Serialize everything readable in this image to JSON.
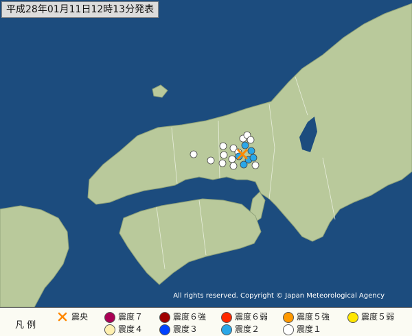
{
  "title": "平成28年01月11日12時13分発表",
  "copyright": "All rights reserved. Copyright © Japan Meteorological Agency",
  "colors": {
    "sea": "#1c4c7e",
    "land": "#b9c99b",
    "epicenter": "#ff8800"
  },
  "legend": {
    "label": "凡 例",
    "items": [
      {
        "name": "epicenter",
        "label": "震央",
        "icon": "cross-icon",
        "color": "#ff8800"
      },
      {
        "name": "shindo-7",
        "label": "震度７",
        "color": "#aa0055"
      },
      {
        "name": "shindo-6plus",
        "label": "震度６強",
        "color": "#a00000"
      },
      {
        "name": "shindo-6minus",
        "label": "震度６弱",
        "color": "#ff2800"
      },
      {
        "name": "shindo-5plus",
        "label": "震度５強",
        "color": "#ff9900"
      },
      {
        "name": "shindo-5minus",
        "label": "震度５弱",
        "color": "#ffe600"
      },
      {
        "name": "shindo-4",
        "label": "震度４",
        "color": "#fff0b0"
      },
      {
        "name": "shindo-3",
        "label": "震度３",
        "color": "#0041ff"
      },
      {
        "name": "shindo-2",
        "label": "震度２",
        "color": "#2aa7e8"
      },
      {
        "name": "shindo-1",
        "label": "震度１",
        "color": "#ffffff"
      }
    ]
  }
}
